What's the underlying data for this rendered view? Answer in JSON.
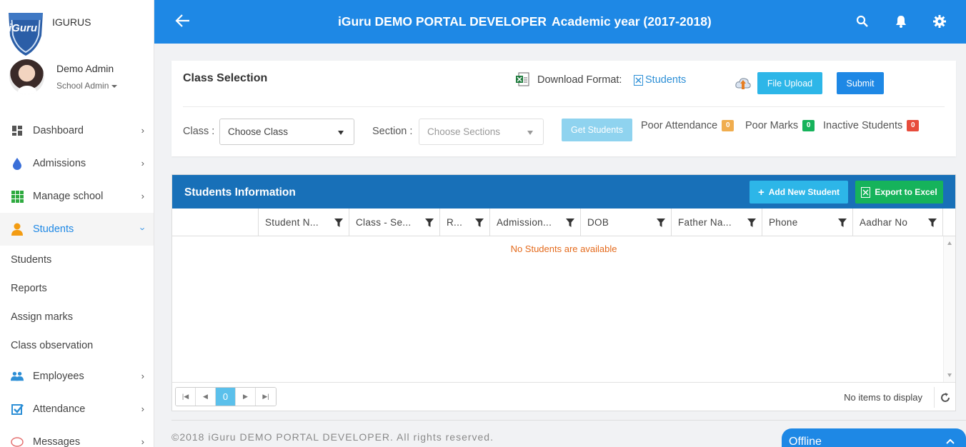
{
  "sidebar": {
    "brand": "IGURUS",
    "logo_text": "iGuru",
    "user_name": "Demo Admin",
    "user_role": "School Admin",
    "nav": [
      {
        "label": "Dashboard",
        "icon": "dashboard-icon"
      },
      {
        "label": "Admissions",
        "icon": "drop-icon"
      },
      {
        "label": "Manage school",
        "icon": "grid-icon"
      },
      {
        "label": "Students",
        "icon": "person-icon",
        "active": true
      },
      {
        "label": "Employees",
        "icon": "group-icon"
      },
      {
        "label": "Attendance",
        "icon": "checkbox-icon"
      },
      {
        "label": "Messages",
        "icon": "chat-icon"
      }
    ],
    "students_sub": [
      "Students",
      "Reports",
      "Assign marks",
      "Class observation"
    ]
  },
  "header": {
    "title": "iGuru DEMO PORTAL DEVELOPER",
    "academic_year": "Academic year (2017-2018)"
  },
  "class_selection": {
    "title": "Class Selection",
    "download_label": "Download Format:",
    "download_link": "Students",
    "file_upload": "File Upload",
    "submit": "Submit",
    "class_label": "Class :",
    "class_value": "Choose Class",
    "section_label": "Section :",
    "section_value": "Choose Sections",
    "get_students": "Get Students",
    "stats": [
      {
        "label": "Poor Attendance",
        "count": "0",
        "color": "#f0ad4e"
      },
      {
        "label": "Poor Marks",
        "count": "0",
        "color": "#16b35b"
      },
      {
        "label": "Inactive Students",
        "count": "0",
        "color": "#e74c3c"
      }
    ]
  },
  "students_info": {
    "title": "Students Information",
    "add_new": "Add New Student",
    "export": "Export to Excel",
    "columns": [
      "Student N...",
      "Class - Se...",
      "R...",
      "Admission...",
      "DOB",
      "Father Na...",
      "Phone",
      "Aadhar No"
    ],
    "empty_message": "No Students are available",
    "current_page": "0",
    "no_items": "No items to display"
  },
  "footer": {
    "copyright": "©2018 iGuru DEMO PORTAL DEVELOPER. All rights reserved."
  },
  "chat": {
    "status": "Offline"
  },
  "colors": {
    "primary": "#1e88e5",
    "panel_header": "#1870b8",
    "info": "#2db6e8",
    "success": "#16b35b",
    "empty_text": "#e46a1c"
  }
}
